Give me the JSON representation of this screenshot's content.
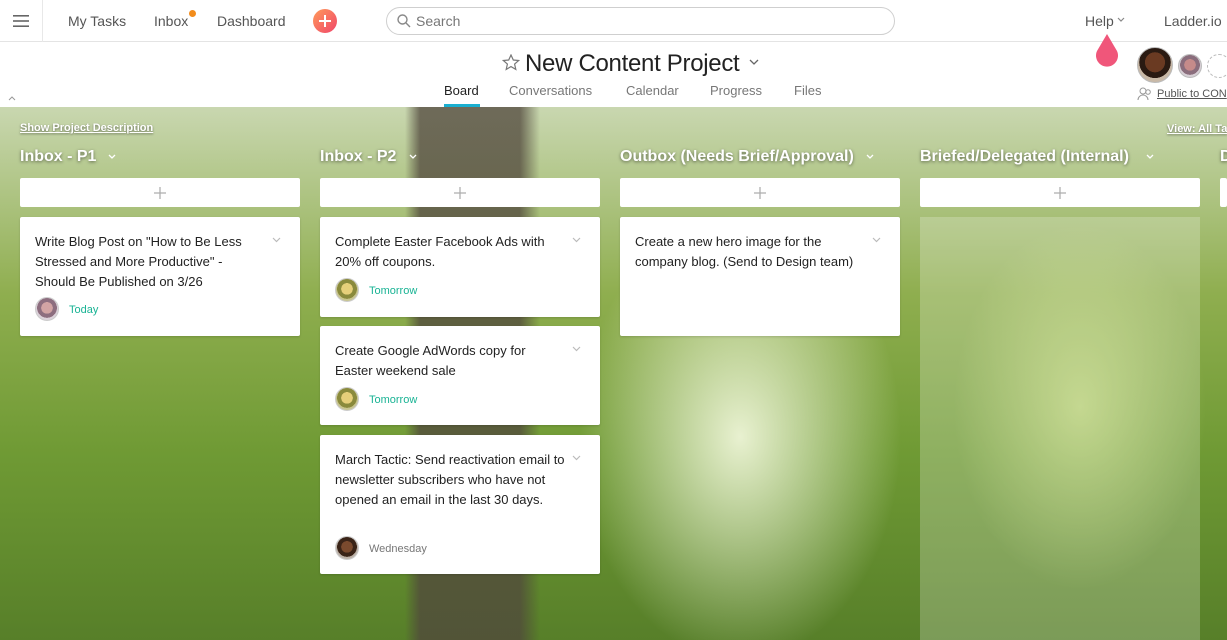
{
  "topbar": {
    "menu_icon": "hamburger-icon",
    "nav": [
      {
        "label": "My Tasks"
      },
      {
        "label": "Inbox",
        "has_notification": true
      },
      {
        "label": "Dashboard"
      }
    ],
    "add_icon": "plus-icon",
    "search_placeholder": "Search",
    "help_label": "Help",
    "org_label": "Ladder.io"
  },
  "project": {
    "title": "New Content Project",
    "star_icon": "star-icon",
    "tabs": [
      {
        "label": "Board",
        "active": true
      },
      {
        "label": "Conversations",
        "active": false
      },
      {
        "label": "Calendar",
        "active": false
      },
      {
        "label": "Progress",
        "active": false
      },
      {
        "label": "Files",
        "active": false
      }
    ],
    "members_visibility": "Public to CON"
  },
  "board": {
    "show_description_label": "Show Project Description",
    "view_all_label": "View: All Ta",
    "columns": [
      {
        "title": "Inbox - P1",
        "cards": [
          {
            "text": "Write Blog Post on \"How to Be Less Stressed and More Productive\" - Should Be Published on 3/26",
            "due": "Today",
            "due_color": "#19b394"
          }
        ]
      },
      {
        "title": "Inbox - P2",
        "cards": [
          {
            "text": "Complete Easter Facebook Ads with 20% off coupons.",
            "due": "Tomorrow",
            "due_color": "#19b394"
          },
          {
            "text": "Create Google AdWords copy for Easter weekend sale",
            "due": "Tomorrow",
            "due_color": "#19b394"
          },
          {
            "text": "March Tactic: Send reactivation email to newsletter subscribers who have not opened an email in the last 30 days.",
            "due": "Wednesday",
            "due_color": "#777777"
          }
        ]
      },
      {
        "title": "Outbox (Needs Brief/Approval)",
        "cards": [
          {
            "text": "Create a new hero image for the company blog. (Send to Design team)"
          }
        ]
      },
      {
        "title": "Briefed/Delegated (Internal)",
        "cards": []
      },
      {
        "title": "D",
        "cards": []
      }
    ]
  },
  "colors": {
    "accent": "#1aafd0",
    "due_green": "#19b394",
    "notification": "#f28c1c",
    "pin": "#f0567a"
  }
}
